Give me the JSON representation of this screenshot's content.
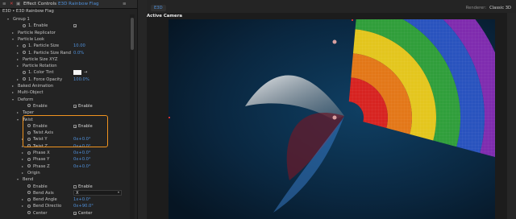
{
  "panel": {
    "title": "Effect Controls",
    "layer": "E3D Rainbow Flag",
    "subheader": "E3D • E3D Rainbow Flag"
  },
  "rows": [
    {
      "indent": 1,
      "tri": "▾",
      "label": "Group 1"
    },
    {
      "indent": 3,
      "sw": true,
      "label": "1. Enable",
      "check": true,
      "check_label": ""
    },
    {
      "indent": 2,
      "tri": "▸",
      "label": "Particle Replicator"
    },
    {
      "indent": 2,
      "tri": "▾",
      "label": "Particle Look"
    },
    {
      "indent": 3,
      "tri": "▸",
      "sw": true,
      "label": "1. Particle Size",
      "value": "10.00"
    },
    {
      "indent": 3,
      "tri": "▸",
      "sw": true,
      "label": "1. Particle Size Rand",
      "value": "0.0%"
    },
    {
      "indent": 3,
      "tri": "▸",
      "label": "Particle Size XYZ"
    },
    {
      "indent": 3,
      "tri": "▸",
      "label": "Particle Rotation"
    },
    {
      "indent": 3,
      "sw": true,
      "label": "1. Color Tint",
      "color": "#f5f5f5"
    },
    {
      "indent": 3,
      "tri": "▸",
      "sw": true,
      "label": "1. Force Opacity",
      "value": "100.0%"
    },
    {
      "indent": 2,
      "tri": "▸",
      "label": "Baked Animation"
    },
    {
      "indent": 2,
      "tri": "▸",
      "label": "Multi-Object"
    },
    {
      "indent": 2,
      "tri": "▾",
      "label": "Deform"
    },
    {
      "indent": 4,
      "sw": true,
      "label": "Enable",
      "check": true,
      "check_label": "Enable"
    },
    {
      "indent": 3,
      "tri": "▸",
      "label": "Taper"
    },
    {
      "indent": 3,
      "tri": "▾",
      "label": "Twist"
    },
    {
      "indent": 4,
      "sw": true,
      "label": "Enable",
      "check": true,
      "check_label": "Enable"
    },
    {
      "indent": 4,
      "sw": true,
      "label": "Twist Axis",
      "value": ""
    },
    {
      "indent": 4,
      "tri": "▸",
      "sw": true,
      "label": "Twist Y",
      "value": "0x+0.0°"
    },
    {
      "indent": 4,
      "tri": "▸",
      "sw": true,
      "label": "Twist Z",
      "value": "0x+0.0°"
    },
    {
      "indent": 4,
      "tri": "▸",
      "sw": true,
      "label": "Phase X",
      "value": "0x+0.0°"
    },
    {
      "indent": 4,
      "tri": "▸",
      "sw": true,
      "label": "Phase Y",
      "value": "0x+0.0°"
    },
    {
      "indent": 4,
      "tri": "▸",
      "sw": true,
      "label": "Phase Z",
      "value": "0x+0.0°"
    },
    {
      "indent": 4,
      "tri": "▸",
      "label": "Origin"
    },
    {
      "indent": 3,
      "tri": "▾",
      "label": "Bend"
    },
    {
      "indent": 4,
      "sw": true,
      "label": "Enable",
      "check": false,
      "check_label": "Enable"
    },
    {
      "indent": 4,
      "sw": true,
      "label": "Bend Axis",
      "select": "X"
    },
    {
      "indent": 4,
      "tri": "▸",
      "sw": true,
      "label": "Bend Angle",
      "value": "1x+0.0°"
    },
    {
      "indent": 4,
      "tri": "▸",
      "sw": true,
      "label": "Bend Directio",
      "value": "0x+90.0°"
    },
    {
      "indent": 4,
      "sw": true,
      "label": "Center",
      "check": true,
      "check_label": "Center"
    }
  ],
  "viewer": {
    "tab": "E3D",
    "camera": "Active Camera",
    "renderer_label": "Renderer:",
    "renderer_value": "Classic 3D"
  },
  "colors": {
    "accent_blue": "#4f8fd8",
    "highlight_orange": "#f0931f",
    "rainbow": [
      "#e8221c",
      "#f57d14",
      "#f6d21a",
      "#34a83a",
      "#2c57c9",
      "#8a2cb8"
    ]
  }
}
